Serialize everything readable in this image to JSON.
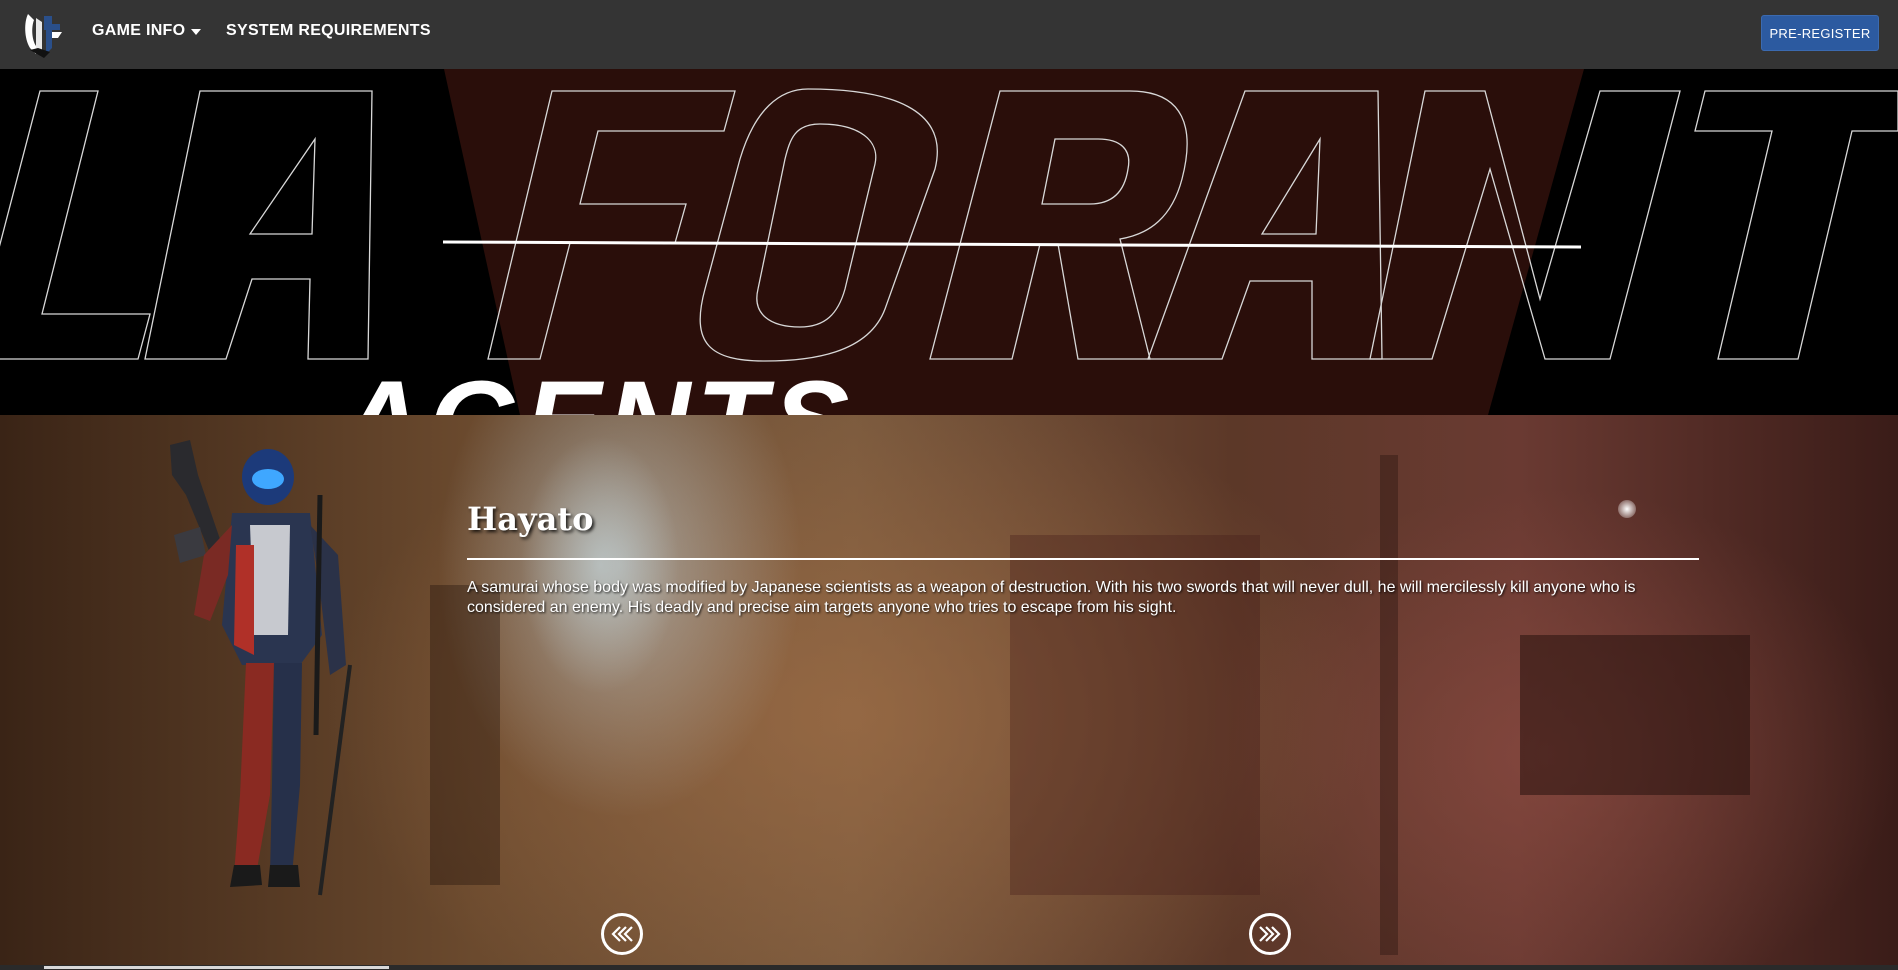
{
  "nav": {
    "logo": "logo-icon",
    "items": [
      {
        "label": "GAME INFO",
        "has_dropdown": true
      },
      {
        "label": "SYSTEM REQUIREMENTS",
        "has_dropdown": false
      }
    ],
    "cta_label": "PRE-REGISTER",
    "background": "#343434",
    "cta_color": "#2c5aa0"
  },
  "hero": {
    "outline_text": "LA FORANT",
    "section_title": "AGENTS",
    "accent_color": "#2a0e0a"
  },
  "agent": {
    "name": "Hayato",
    "description": "A samurai whose body was modified by Japanese scientists as a weapon of destruction. With his two swords that will never dull, he will mercilessly kill anyone who is considered an enemy. His deadly and precise aim targets anyone who tries to escape from his sight.",
    "prev_icon": "double-chevron-left-icon",
    "next_icon": "double-chevron-right-icon"
  }
}
